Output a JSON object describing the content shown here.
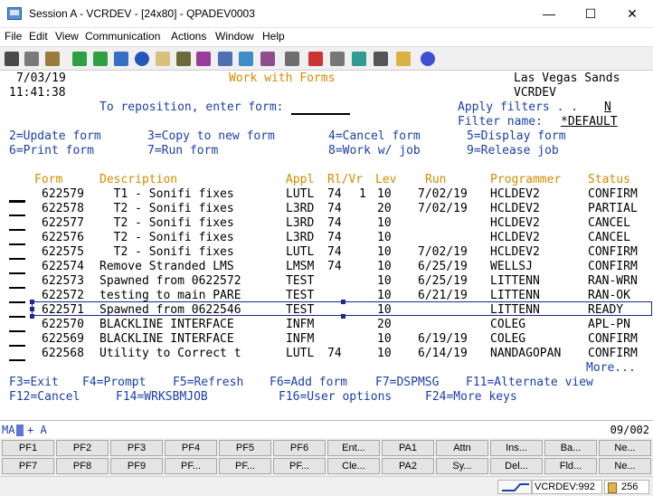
{
  "window": {
    "title": "Session A - VCRDEV - [24x80] - QPADEV0003",
    "minimize_glyph": "—",
    "maximize_glyph": "☐",
    "close_glyph": "✕"
  },
  "menu": [
    "File",
    "Edit",
    "View",
    "Communication",
    "Actions",
    "Window",
    "Help"
  ],
  "toolbar_icons": [
    "print-screen-icon",
    "copy-icon",
    "paste-icon",
    "send-icon",
    "receive-icon",
    "display-icon",
    "compass-icon",
    "notes-icon",
    "record-icon",
    "macro-icon",
    "stop-icon",
    "keypad-icon",
    "map-icon",
    "grid-icon",
    "edit-icon",
    "red-x-icon",
    "record-start-icon",
    "play-icon",
    "pause-icon",
    "notepad-icon",
    "help-icon"
  ],
  "screen": {
    "date": "7/03/19",
    "time": "11:41:38",
    "title": "Work with Forms",
    "company": "Las Vegas Sands",
    "system": "VCRDEV",
    "reposition_label": "To reposition, enter form:",
    "apply_filters_label": "Apply filters . .",
    "apply_filters_value": "N",
    "filter_name_label": "Filter name:",
    "filter_name_value": "*DEFAULT",
    "options_row1": [
      "2=Update form",
      "3=Copy to new form",
      "4=Cancel form",
      "5=Display form"
    ],
    "options_row2": [
      "6=Print form",
      "7=Run form",
      "8=Work w/ job",
      "9=Release job"
    ],
    "headers": {
      "form": "Form",
      "description": "Description",
      "appl": "Appl",
      "rlvr": "Rl/Vr",
      "lev": "Lev",
      "run": "Run",
      "programmer": "Programmer",
      "status": "Status"
    },
    "rows": [
      {
        "form": "622579",
        "desc": "  T1 - Sonifi fixes",
        "appl": "LUTL",
        "rl": "74",
        "vr": "1",
        "lev": "10",
        "run": "7/02/19",
        "programmer": "HCLDEV2",
        "status": "CONFIRM"
      },
      {
        "form": "622578",
        "desc": "  T2 - Sonifi fixes",
        "appl": "L3RD",
        "rl": "74",
        "vr": "",
        "lev": "20",
        "run": "7/02/19",
        "programmer": "HCLDEV2",
        "status": "PARTIAL"
      },
      {
        "form": "622577",
        "desc": "  T2 - Sonifi fixes",
        "appl": "L3RD",
        "rl": "74",
        "vr": "",
        "lev": "10",
        "run": "",
        "programmer": "HCLDEV2",
        "status": "CANCEL"
      },
      {
        "form": "622576",
        "desc": "  T2 - Sonifi fixes",
        "appl": "L3RD",
        "rl": "74",
        "vr": "",
        "lev": "10",
        "run": "",
        "programmer": "HCLDEV2",
        "status": "CANCEL"
      },
      {
        "form": "622575",
        "desc": "  T2 - Sonifi fixes",
        "appl": "LUTL",
        "rl": "74",
        "vr": "",
        "lev": "10",
        "run": "7/02/19",
        "programmer": "HCLDEV2",
        "status": "CONFIRM"
      },
      {
        "form": "622574",
        "desc": "Remove Stranded LMS",
        "appl": "LMSM",
        "rl": "74",
        "vr": "",
        "lev": "10",
        "run": "6/25/19",
        "programmer": "WELLSJ",
        "status": "CONFIRM"
      },
      {
        "form": "622573",
        "desc": "Spawned from 0622572",
        "appl": "TEST",
        "rl": "",
        "vr": "",
        "lev": "10",
        "run": "6/25/19",
        "programmer": "LITTENN",
        "status": "RAN-WRN"
      },
      {
        "form": "622572",
        "desc": "testing to main PARE",
        "appl": "TEST",
        "rl": "",
        "vr": "",
        "lev": "10",
        "run": "6/21/19",
        "programmer": "LITTENN",
        "status": "RAN-OK"
      },
      {
        "form": "622571",
        "desc": "Spawned from 0622546",
        "appl": "TEST",
        "rl": "",
        "vr": "",
        "lev": "10",
        "run": "",
        "programmer": "LITTENN",
        "status": "READY"
      },
      {
        "form": "622570",
        "desc": "BLACKLINE INTERFACE",
        "appl": "INFM",
        "rl": "",
        "vr": "",
        "lev": "20",
        "run": "",
        "programmer": "COLEG",
        "status": "APL-PN"
      },
      {
        "form": "622569",
        "desc": "BLACKLINE INTERFACE",
        "appl": "INFM",
        "rl": "",
        "vr": "",
        "lev": "10",
        "run": "6/19/19",
        "programmer": "COLEG",
        "status": "CONFIRM"
      },
      {
        "form": "622568",
        "desc": "Utility to Correct t",
        "appl": "LUTL",
        "rl": "74",
        "vr": "",
        "lev": "10",
        "run": "6/14/19",
        "programmer": "NANDAGOPAN",
        "status": "CONFIRM"
      }
    ],
    "more": "More...",
    "fkeys_row1": [
      "F3=Exit",
      "F4=Prompt",
      "F5=Refresh",
      "F6=Add form",
      "F7=DSPMSG",
      "F11=Alternate view"
    ],
    "fkeys_row2": [
      "F12=Cancel",
      "F14=WRKSBMJOB",
      "F16=User options",
      "F24=More keys"
    ]
  },
  "oia": {
    "left": "MA",
    "mid": "+   A",
    "position": "09/002"
  },
  "keypad_row1": [
    "PF1",
    "PF2",
    "PF3",
    "PF4",
    "PF5",
    "PF6",
    "Ent...",
    "PA1",
    "Attn",
    "Ins...",
    "Ba...",
    "Ne..."
  ],
  "keypad_row2": [
    "PF7",
    "PF8",
    "PF9",
    "PF...",
    "PF...",
    "PF...",
    "Cle...",
    "PA2",
    "Sy...",
    "Del...",
    "Fld...",
    "Ne..."
  ],
  "statusbar": {
    "session": "VCRDEV:992",
    "port": "256"
  }
}
